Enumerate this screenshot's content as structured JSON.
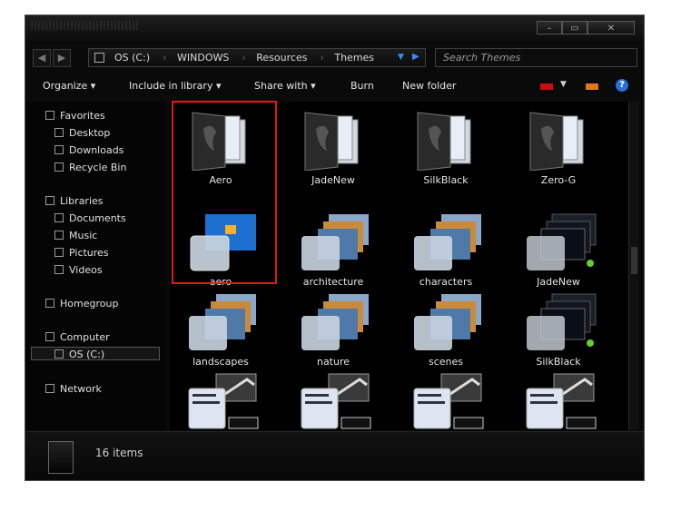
{
  "window": {
    "controls": {
      "minimize": "–",
      "maximize": "▭",
      "close": "✕"
    }
  },
  "address": {
    "back_glyph": "◀",
    "forward_glyph": "▶",
    "crumbs": [
      "OS (C:)",
      "WINDOWS",
      "Resources",
      "Themes"
    ],
    "search_placeholder": "Search Themes"
  },
  "toolbar": {
    "organize": "Organize ▾",
    "include": "Include in library ▾",
    "share": "Share with ▾",
    "burn": "Burn",
    "new_folder": "New folder",
    "help": "?"
  },
  "nav": {
    "favorites": "Favorites",
    "desktop": "Desktop",
    "downloads": "Downloads",
    "recycle": "Recycle Bin",
    "libraries": "Libraries",
    "documents": "Documents",
    "music": "Music",
    "pictures": "Pictures",
    "videos": "Videos",
    "homegroup": "Homegroup",
    "computer": "Computer",
    "osc": "OS (C:)",
    "network": "Network"
  },
  "items": [
    {
      "label": "Aero",
      "kind": "folder"
    },
    {
      "label": "JadeNew",
      "kind": "folder"
    },
    {
      "label": "SilkBlack",
      "kind": "folder"
    },
    {
      "label": "Zero-G",
      "kind": "folder"
    },
    {
      "label": "aero",
      "kind": "theme-aero"
    },
    {
      "label": "architecture",
      "kind": "theme"
    },
    {
      "label": "characters",
      "kind": "theme"
    },
    {
      "label": "JadeNew",
      "kind": "theme-dark"
    },
    {
      "label": "landscapes",
      "kind": "theme"
    },
    {
      "label": "nature",
      "kind": "theme"
    },
    {
      "label": "scenes",
      "kind": "theme"
    },
    {
      "label": "SilkBlack",
      "kind": "theme-dark"
    },
    {
      "label": "",
      "kind": "zero-g"
    },
    {
      "label": "",
      "kind": "zero-g"
    },
    {
      "label": "",
      "kind": "zero-g"
    },
    {
      "label": "",
      "kind": "zero-g"
    }
  ],
  "status": {
    "count": "16 items"
  },
  "colors": {
    "selection": "#e01818",
    "window_bg": "#0a0a0a",
    "help_blue": "#2a6fd6"
  }
}
